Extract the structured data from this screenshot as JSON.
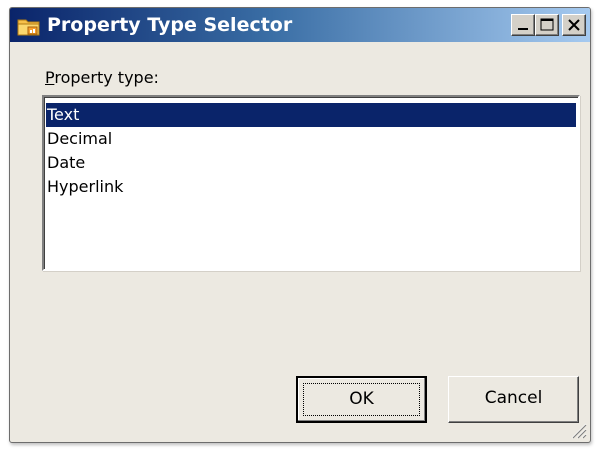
{
  "window": {
    "title": "Property Type Selector",
    "title_icon": "folder-app-icon",
    "controls": {
      "minimize": "minimize-icon",
      "maximize": "maximize-icon",
      "close": "close-icon"
    }
  },
  "form": {
    "label": "Property type:",
    "label_access_key": "P",
    "options": [
      "Text",
      "Decimal",
      "Date",
      "Hyperlink"
    ],
    "selected": "Text"
  },
  "buttons": {
    "ok": "OK",
    "cancel": "Cancel"
  },
  "colors": {
    "title_gradient_start": "#0a246a",
    "title_gradient_end": "#a6caf0",
    "selection": "#0a246a",
    "face": "#ece9e1"
  }
}
